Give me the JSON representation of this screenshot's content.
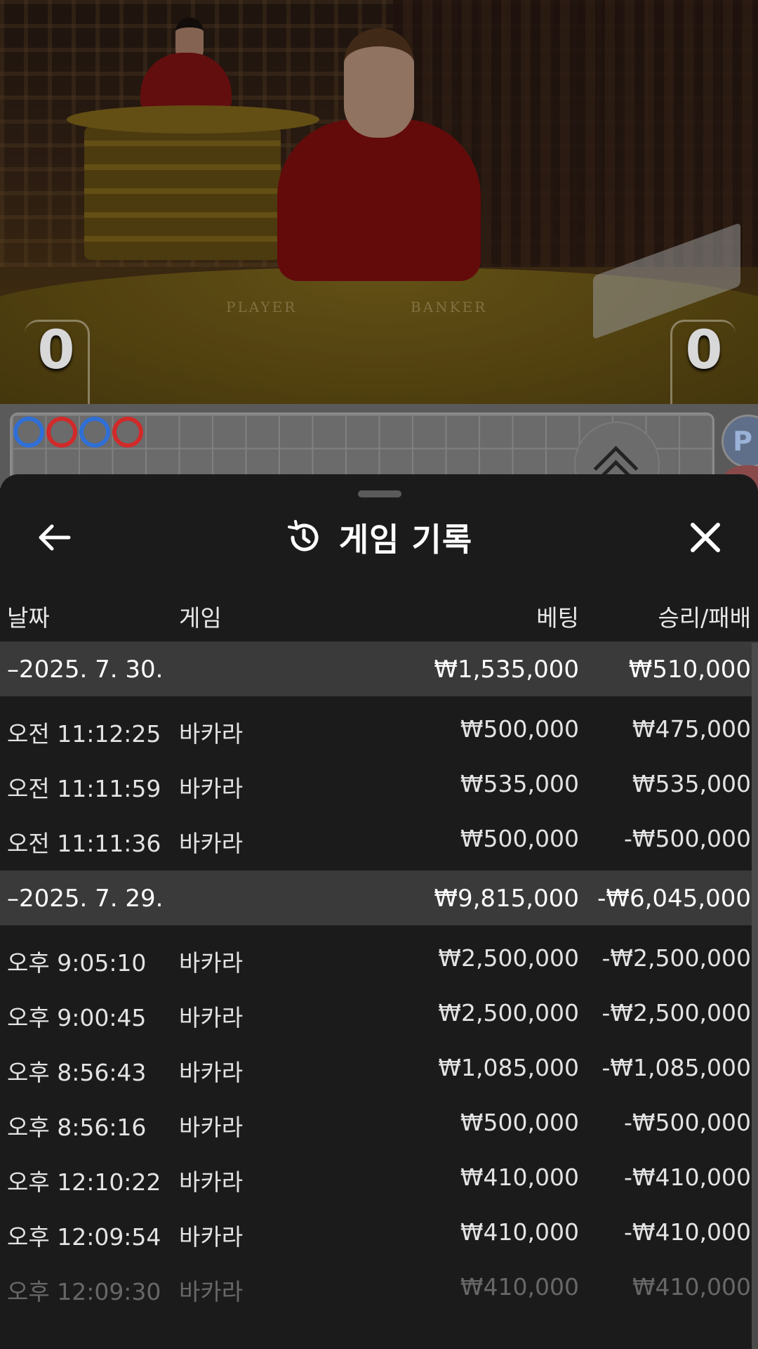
{
  "video": {
    "player_score": "0",
    "banker_score": "0",
    "felt_player_label": "PLAYER",
    "felt_banker_label": "BANKER"
  },
  "roadmap": {
    "beads": [
      {
        "color": "#2f6fd6",
        "icon": "blue-ring"
      },
      {
        "color": "#d02a2a",
        "icon": "red-ring"
      },
      {
        "color": "#2f6fd6",
        "icon": "blue-ring"
      },
      {
        "color": "#d02a2a",
        "icon": "red-ring"
      }
    ],
    "side_badge": "P"
  },
  "sheet": {
    "title": "게임 기록",
    "icons": {
      "back": "arrow-left-icon",
      "history": "history-icon",
      "close": "close-icon"
    },
    "columns": {
      "date": "날짜",
      "game": "게임",
      "bet": "베팅",
      "result": "승리/패배"
    },
    "groups": [
      {
        "date": "–2025. 7. 30.",
        "bet_total": "₩1,535,000",
        "result_total": "₩510,000",
        "rows": [
          {
            "time": "오전 11:12:25",
            "game": "바카라",
            "bet": "₩500,000",
            "result": "₩475,000"
          },
          {
            "time": "오전 11:11:59",
            "game": "바카라",
            "bet": "₩535,000",
            "result": "₩535,000"
          },
          {
            "time": "오전 11:11:36",
            "game": "바카라",
            "bet": "₩500,000",
            "result": "-₩500,000"
          }
        ]
      },
      {
        "date": "–2025. 7. 29.",
        "bet_total": "₩9,815,000",
        "result_total": "-₩6,045,000",
        "rows": [
          {
            "time": "오후 9:05:10",
            "game": "바카라",
            "bet": "₩2,500,000",
            "result": "-₩2,500,000"
          },
          {
            "time": "오후 9:00:45",
            "game": "바카라",
            "bet": "₩2,500,000",
            "result": "-₩2,500,000"
          },
          {
            "time": "오후 8:56:43",
            "game": "바카라",
            "bet": "₩1,085,000",
            "result": "-₩1,085,000"
          },
          {
            "time": "오후 8:56:16",
            "game": "바카라",
            "bet": "₩500,000",
            "result": "-₩500,000"
          },
          {
            "time": "오후 12:10:22",
            "game": "바카라",
            "bet": "₩410,000",
            "result": "-₩410,000"
          },
          {
            "time": "오후 12:09:54",
            "game": "바카라",
            "bet": "₩410,000",
            "result": "-₩410,000"
          },
          {
            "time": "오후 12:09:30",
            "game": "바카라",
            "bet": "₩410,000",
            "result": "₩410,000"
          }
        ]
      }
    ]
  }
}
